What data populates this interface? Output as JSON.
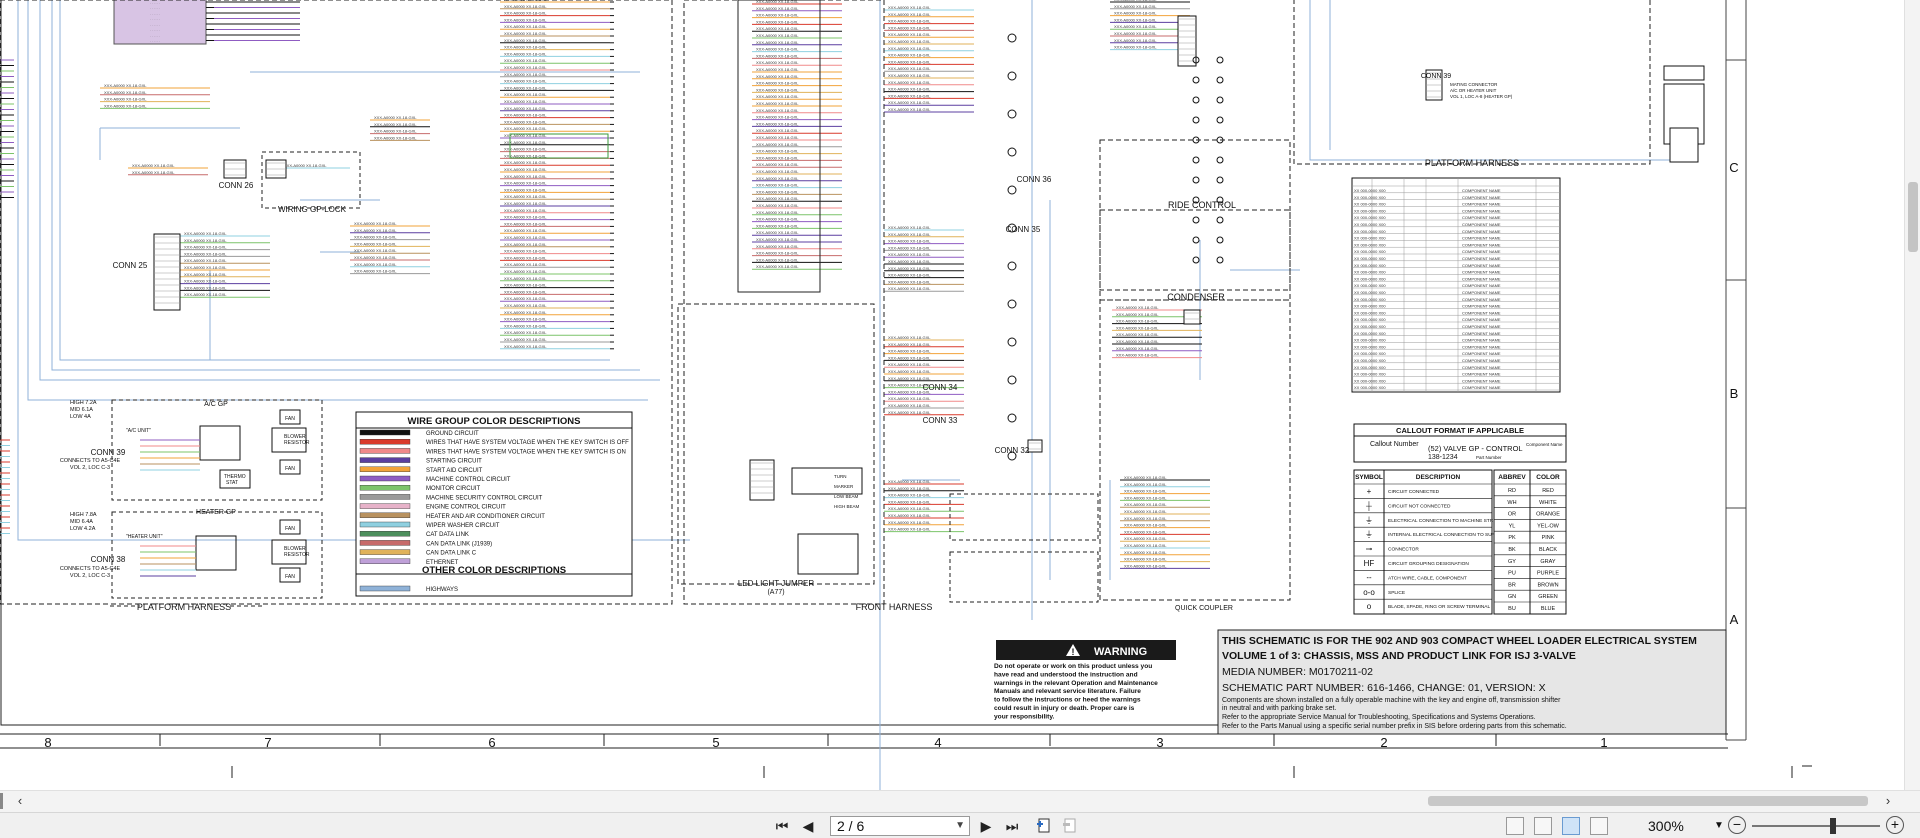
{
  "schematic": {
    "column_numbers": [
      "8",
      "7",
      "6",
      "5",
      "4",
      "3",
      "2",
      "1"
    ],
    "row_letters": [
      "C",
      "B",
      "A"
    ],
    "harness_labels": {
      "platform_left": "PLATFORM HARNESS",
      "front": "FRONT HARNESS",
      "quick_coupler": "QUICK COUPLER",
      "platform_right": "PLATFORM HARNESS",
      "ride_control": "RIDE CONTROL",
      "condenser": "CONDENSER",
      "wiring_gp_lock": "WIRING GP-LOCK",
      "led_light_jumper": "LED LIGHT JUMPER",
      "led_light_jumper_sub": "(A77)",
      "ac_gp": "A/C GP",
      "heater_gp": "HEATER GP"
    },
    "connectors": [
      "CONN 25",
      "CONN 26",
      "CONN 36",
      "CONN 35",
      "CONN 34",
      "CONN 33",
      "CONN 32",
      "CONN 39",
      "CONN 38",
      "CONN 39"
    ],
    "conn39_right_notes": [
      "MATING CONNECTOR",
      "A/C OR HEATER UNIT",
      "VOL 1, LOC A-8 (HEATER GP)"
    ],
    "left_notes": {
      "high_low_ac": [
        "HIGH 7.2A",
        "MID 6.1A",
        "LOW 4A"
      ],
      "high_low_heater": [
        "HIGH 7.8A",
        "MID 6.4A",
        "LOW 4.2A"
      ],
      "conn39_connects": [
        "CONNECTS TO A5-C4E",
        "VOL 2, LOC C-3"
      ],
      "conn38_connects": [
        "CONNECTS TO A5-C4E",
        "VOL 2, LOC C-3"
      ]
    },
    "wire_color_legend": {
      "title": "WIRE GROUP COLOR DESCRIPTIONS",
      "items": [
        {
          "color": "#111111",
          "label": "GROUND CIRCUIT"
        },
        {
          "color": "#d93a2b",
          "label": "WIRES THAT HAVE SYSTEM VOLTAGE WHEN THE KEY SWITCH IS OFF"
        },
        {
          "color": "#f08a8a",
          "label": "WIRES THAT HAVE SYSTEM VOLTAGE WHEN THE KEY SWITCH IS ON"
        },
        {
          "color": "#5b3fa0",
          "label": "STARTING CIRCUIT"
        },
        {
          "color": "#f2a33a",
          "label": "START AID CIRCUIT"
        },
        {
          "color": "#8f5cc2",
          "label": "MACHINE CONTROL CIRCUIT"
        },
        {
          "color": "#7cc46a",
          "label": "MONITOR CIRCUIT"
        },
        {
          "color": "#9a9a9a",
          "label": "MACHINE SECURITY CONTROL CIRCUIT"
        },
        {
          "color": "#e7b2c9",
          "label": "ENGINE CONTROL CIRCUIT"
        },
        {
          "color": "#b9925f",
          "label": "HEATER AND AIR CONDITIONER CIRCUIT"
        },
        {
          "color": "#8fd0e0",
          "label": "WIPER WASHER CIRCUIT"
        },
        {
          "color": "#4d8f5d",
          "label": "CAT DATA LINK"
        },
        {
          "color": "#c76b6b",
          "label": "CAN DATA LINK (J1939)"
        },
        {
          "color": "#e0b25a",
          "label": "CAN DATA LINK C"
        },
        {
          "color": "#bfa0d8",
          "label": "ETHERNET"
        }
      ],
      "other_title": "OTHER COLOR DESCRIPTIONS",
      "other_items": [
        {
          "color": "#8fb2d8",
          "label": "HIGHWAYS"
        }
      ]
    },
    "callout_format": {
      "title": "CALLOUT FORMAT IF APPLICABLE",
      "callout_number": "Callout Number",
      "sample": "(52) VALVE GP - CONTROL",
      "sample_code": "138-1234",
      "part_number": "Part Number",
      "component_name": "Component Name"
    },
    "symbol_legend": {
      "headers": [
        "SYMBOL",
        "DESCRIPTION"
      ],
      "rows": [
        {
          "symbol": "+",
          "desc": "CIRCUIT CONNECTED"
        },
        {
          "symbol": "┼",
          "desc": "CIRCUIT NOT CONNECTED"
        },
        {
          "symbol": "⏚",
          "desc": "ELECTRICAL CONNECTION TO MACHINE STRUCTURE"
        },
        {
          "symbol": "⏚",
          "desc": "INTERNAL ELECTRICAL CONNECTION TO SURFACE OF COMPONENT"
        },
        {
          "symbol": "⊸",
          "desc": "CONNECTOR"
        },
        {
          "symbol": "HF",
          "desc": "CIRCUIT GROUPING DESIGNATION"
        },
        {
          "symbol": "┄",
          "desc": "ATCH WIRE, CABLE, COMPONENT"
        },
        {
          "symbol": "o-o",
          "desc": "SPLICE"
        },
        {
          "symbol": "o",
          "desc": "BLADE, SPADE, RING OR SCREW TERMINAL"
        }
      ]
    },
    "abbrev_color": {
      "headers": [
        "ABBREV",
        "COLOR"
      ],
      "rows": [
        [
          "RD",
          "RED"
        ],
        [
          "WH",
          "WHITE"
        ],
        [
          "OR",
          "ORANGE"
        ],
        [
          "YL",
          "YEL-OW"
        ],
        [
          "PK",
          "PINK"
        ],
        [
          "BK",
          "BLACK"
        ],
        [
          "GY",
          "GRAY"
        ],
        [
          "PU",
          "PURPLE"
        ],
        [
          "BR",
          "BROWN"
        ],
        [
          "GN",
          "GREEN"
        ],
        [
          "BU",
          "BLUE"
        ]
      ]
    },
    "warning": {
      "title": "WARNING",
      "text": "Do not operate or work on this product unless you have read and understood the instruction and warnings in the relevant Operation and Maintenance Manuals and relevant service literature. Failure to follow the instructions or heed the warnings could result in injury or death. Proper care is your responsibility."
    },
    "title_block": {
      "line1": "THIS SCHEMATIC IS FOR THE 902 AND 903 COMPACT WHEEL LOADER ELECTRICAL SYSTEM",
      "line2": "VOLUME 1 of 3: CHASSIS, MSS AND PRODUCT LINK FOR ISJ 3-VALVE",
      "media": "MEDIA NUMBER: M0170211-02",
      "part": "SCHEMATIC PART NUMBER: 616-1466, CHANGE: 01, VERSION: X",
      "note1": "Components are shown installed on a fully operable machine with the key and engine off, transmission shifter",
      "note2": "in neutral and with parking brake set.",
      "note3": "Refer to the appropriate Service Manual for Troubleshooting, Specifications and Systems Operations.",
      "note4": "Refer to the Parts Manual using a specific serial number prefix in SIS before ordering parts from this schematic."
    },
    "colors": {
      "highway": "#8fb2d8",
      "ground": "#111111",
      "purple_fill": "#d8c4e4"
    }
  },
  "viewer": {
    "page_value": "2 / 6",
    "zoom": "300%",
    "nav_first": "⏮",
    "nav_prev": "◀",
    "nav_next": "▶",
    "nav_last": "⏭",
    "scroll_left": "‹",
    "scroll_right": "›"
  }
}
